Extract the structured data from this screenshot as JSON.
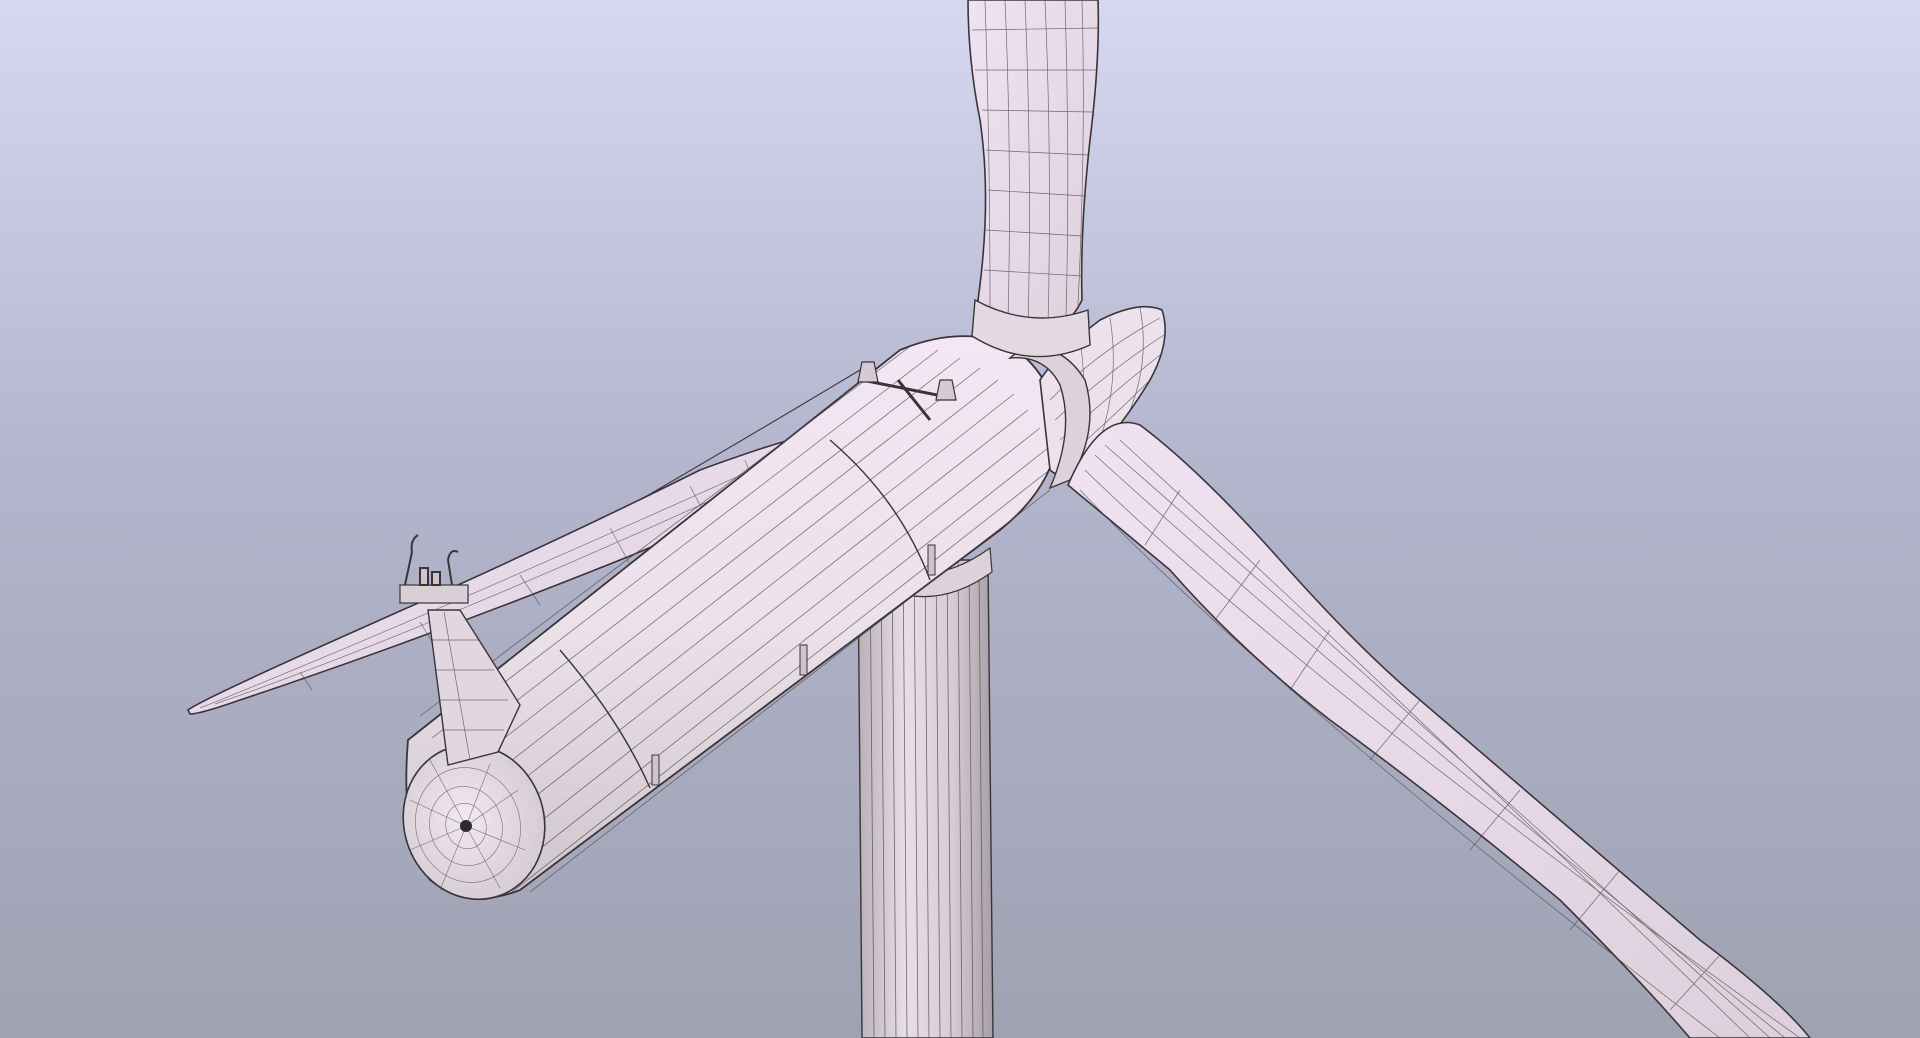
{
  "scene": {
    "subject": "wind-turbine-wireframe-render",
    "background_top_color": "#d6d8f2",
    "background_bottom_color": "#9fa2b2",
    "surface_color": "#eee4ee",
    "surface_highlight_color": "#f3e3f6",
    "wire_color": "#3a3438"
  }
}
